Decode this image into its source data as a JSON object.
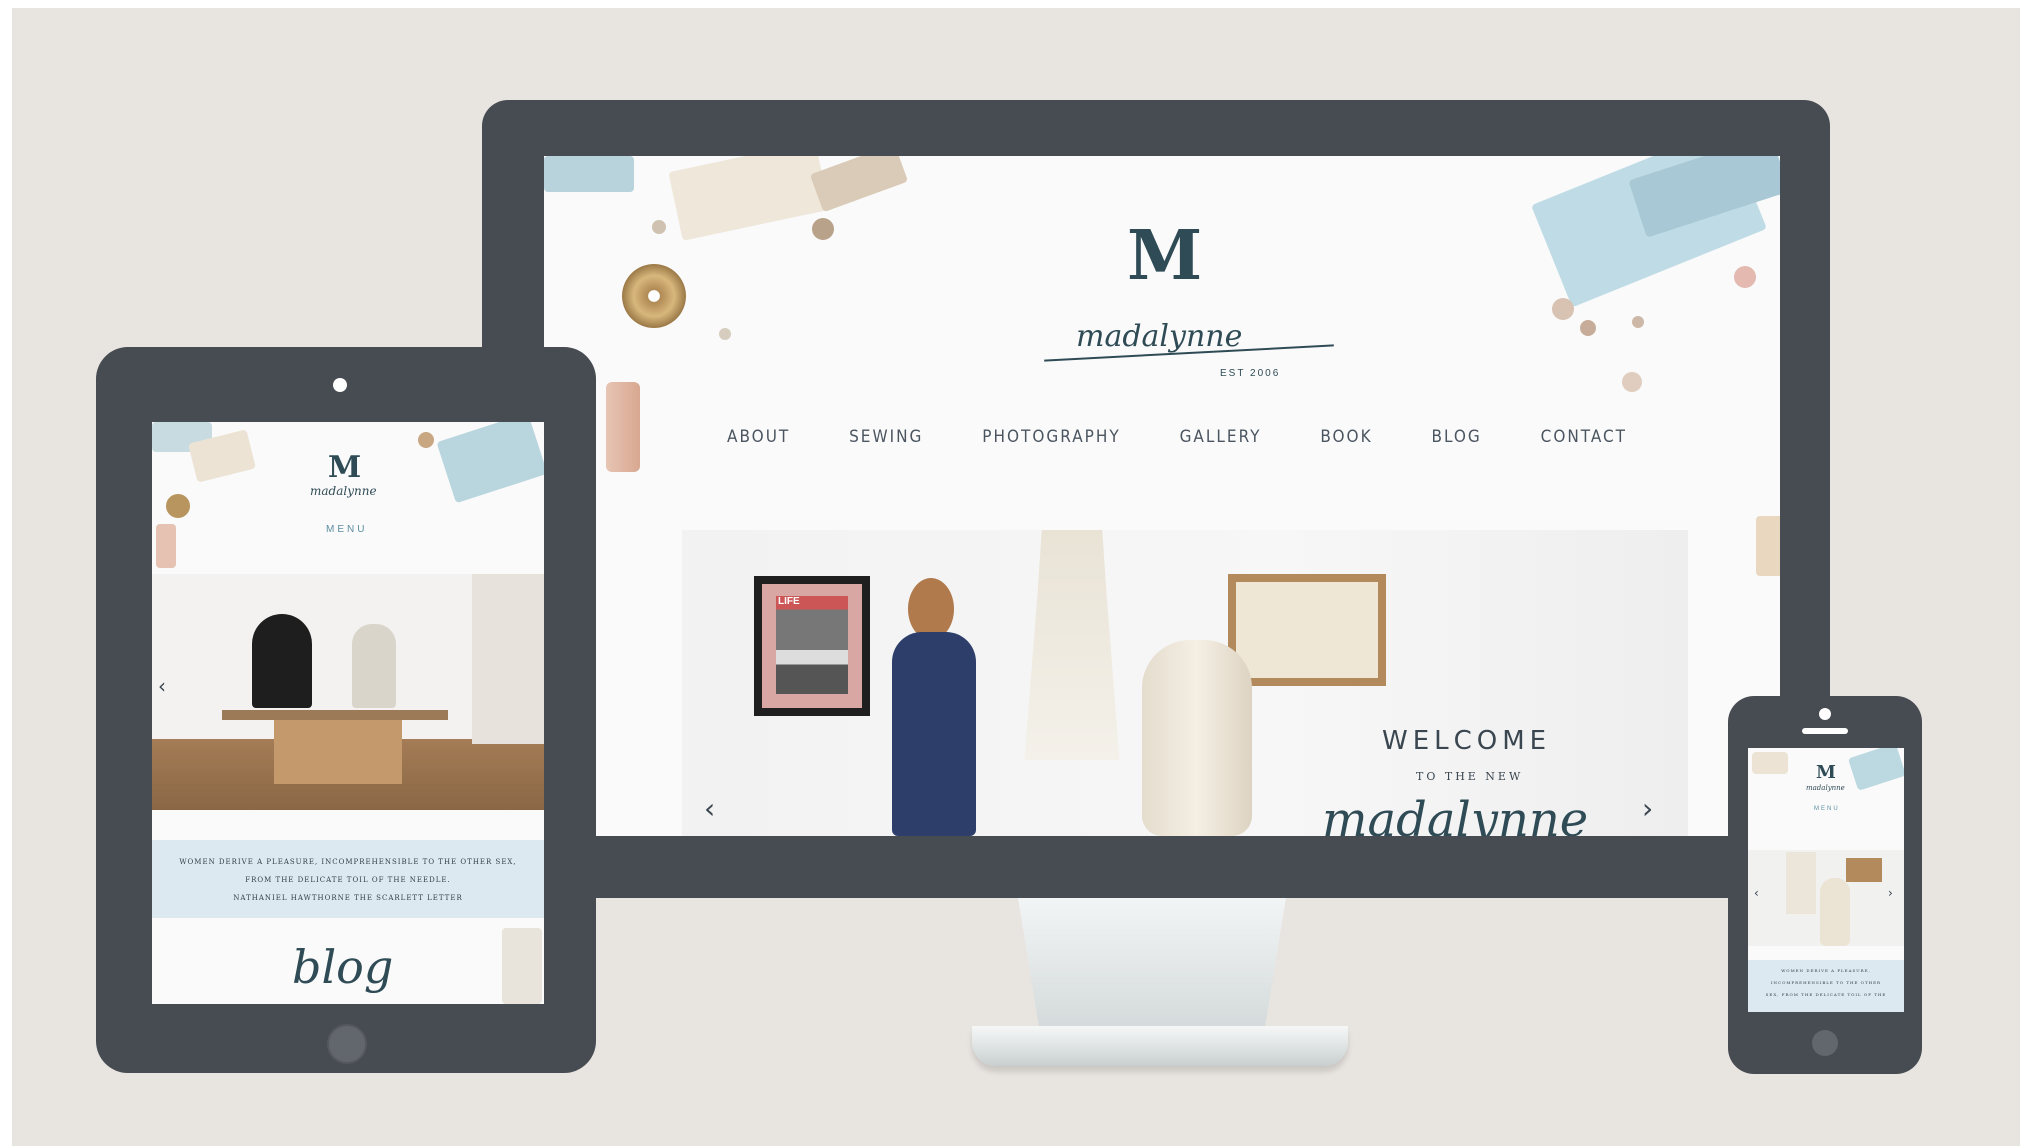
{
  "monitor": {
    "logo": {
      "letter": "M",
      "script": "madalynne",
      "est": "EST 2006"
    },
    "nav": [
      "ABOUT",
      "SEWING",
      "PHOTOGRAPHY",
      "GALLERY",
      "BOOK",
      "BLOG",
      "CONTACT"
    ],
    "hero": {
      "welcome": "WELCOME",
      "subtitle": "TO THE NEW",
      "script": "madalynne",
      "magazine_text": "LIFE",
      "prev_icon": "chevron-left-icon",
      "next_icon": "chevron-right-icon"
    }
  },
  "tablet": {
    "logo": {
      "letter": "M",
      "script": "madalynne"
    },
    "menu": "MENU",
    "quote_lines": [
      "WOMEN DERIVE A PLEASURE, INCOMPREHENSIBLE TO THE OTHER SEX,",
      "FROM THE DELICATE TOIL OF THE NEEDLE.",
      "NATHANIEL HAWTHORNE THE SCARLETT LETTER"
    ],
    "blog": "blog",
    "prev_icon": "chevron-left-icon"
  },
  "phone": {
    "logo": {
      "letter": "M",
      "script": "madalynne"
    },
    "menu": "MENU",
    "quote_lines": [
      "WOMEN DERIVE A PLEASURE,",
      "INCOMPREHENSIBLE TO THE OTHER",
      "SEX, FROM THE DELICATE TOIL OF THE"
    ],
    "prev_icon": "chevron-left-icon",
    "next_icon": "chevron-right-icon"
  },
  "colors": {
    "background": "#e8e4e0",
    "device": "#474c52",
    "brand": "#2f4b56",
    "quote_band": "#dce9f1"
  }
}
